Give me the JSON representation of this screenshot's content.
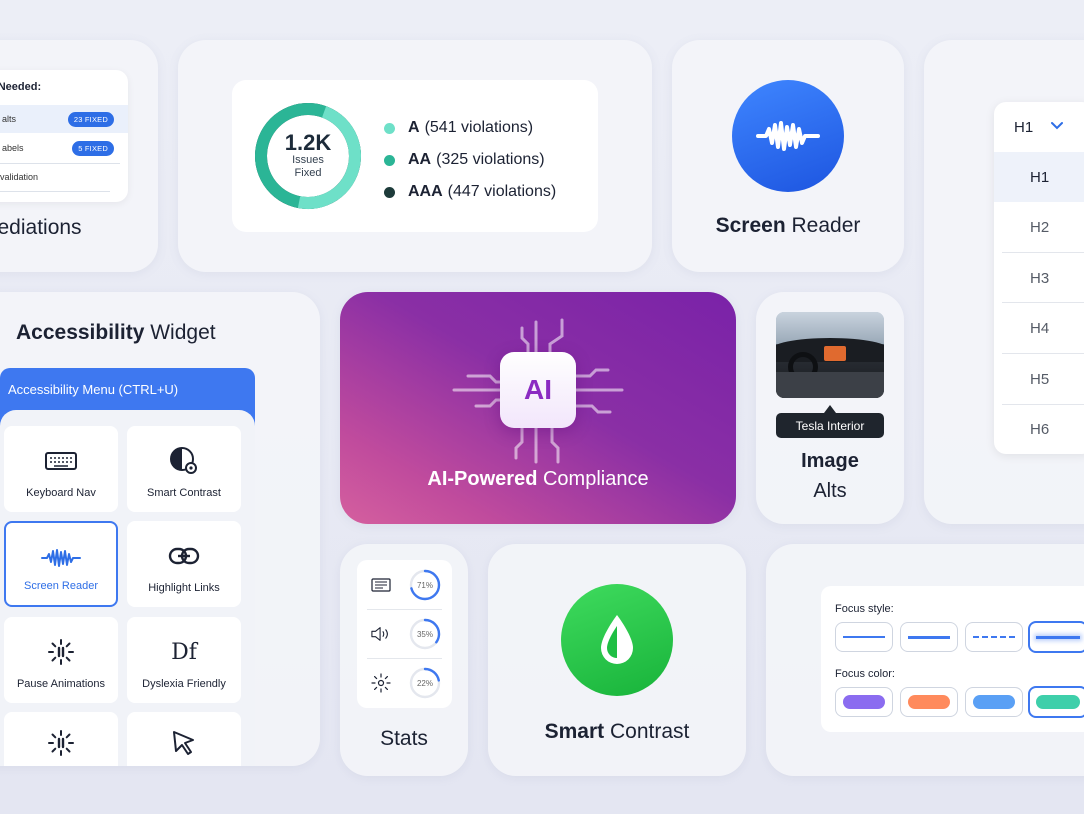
{
  "remediations": {
    "panel_title": "ew Needed:",
    "rows": [
      {
        "label": "alts",
        "badge": "23 FIXED"
      },
      {
        "label": "abels",
        "badge": "5 FIXED"
      },
      {
        "label": "validation",
        "badge": ""
      }
    ],
    "card_label": "mediations"
  },
  "violations": {
    "total": "1.2K",
    "total_caption_1": "Issues",
    "total_caption_2": "Fixed",
    "levels": [
      {
        "level": "A",
        "detail": "(541 violations)",
        "count": 541,
        "color": "#6ee0c8"
      },
      {
        "level": "AA",
        "detail": "(325 violations)",
        "count": 325,
        "color": "#2bb596"
      },
      {
        "level": "AAA",
        "detail": "(447 violations)",
        "count": 447,
        "color": "#1d3b3a"
      }
    ]
  },
  "screen_reader": {
    "bold": "Screen",
    "rest": " Reader",
    "icon": "soundwave-icon"
  },
  "headings": {
    "selected": "H1",
    "options": [
      "H1",
      "H2",
      "H3",
      "H4",
      "H5",
      "H6"
    ]
  },
  "widget": {
    "title_bold": "Accessibility",
    "title_rest": " Widget",
    "menu_label": "Accessibility Menu (CTRL+U)",
    "tiles": [
      {
        "label": "Keyboard Nav",
        "icon": "keyboard-icon"
      },
      {
        "label": "Smart Contrast",
        "icon": "contrast-gear-icon"
      },
      {
        "label": "Screen Reader",
        "icon": "soundwave-icon"
      },
      {
        "label": "Highlight Links",
        "icon": "link-icon"
      },
      {
        "label": "Pause Animations",
        "icon": "pause-spinner-icon"
      },
      {
        "label": "Dyslexia Friendly",
        "icon": "dyslexia-icon"
      },
      {
        "label": "",
        "icon": "pause-spinner-icon"
      },
      {
        "label": "",
        "icon": "cursor-icon"
      }
    ],
    "dyslexia_glyph": "Df"
  },
  "ai": {
    "chip": "AI",
    "bold": "AI-Powered",
    "rest": " Compliance"
  },
  "image_alts": {
    "tooltip": "Tesla Interior",
    "title": "Image",
    "sub": "Alts"
  },
  "stats": {
    "label": "Stats",
    "rows": [
      {
        "icon": "document-icon",
        "pct": "71%",
        "value": 0.71
      },
      {
        "icon": "speaker-icon",
        "pct": "35%",
        "value": 0.35
      },
      {
        "icon": "brightness-icon",
        "pct": "22%",
        "value": 0.22
      }
    ]
  },
  "smart_contrast": {
    "bold": "Smart",
    "rest": " Contrast",
    "icon": "droplet-icon"
  },
  "focus": {
    "style_label": "Focus style:",
    "color_label": "Focus color:",
    "styles": [
      "thin-line",
      "thick-line",
      "dashed-line",
      "glow-line"
    ],
    "colors": [
      "#8b6cf0",
      "#ff8a5c",
      "#5aa0f5",
      "#3ecfaa"
    ],
    "selected_style": 3,
    "selected_color": 3
  },
  "colors": {
    "accent": "#3e78f0",
    "ai_purple": "#8b2bc2",
    "green": "#1fbf44"
  }
}
